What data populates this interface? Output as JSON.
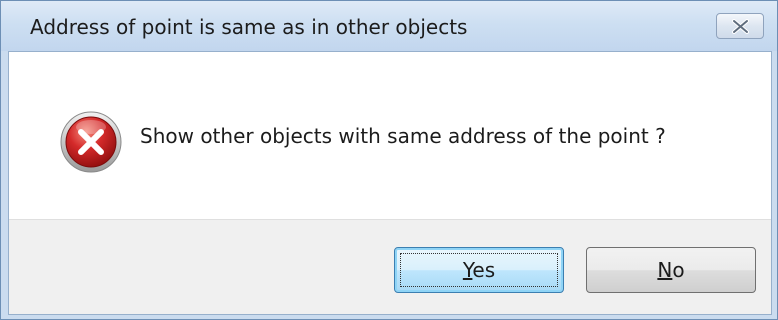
{
  "window": {
    "title": "Address of point is same as in other objects"
  },
  "message": {
    "text": "Show other objects with same address of the point ?"
  },
  "icons": {
    "close": "close-icon",
    "main": "error-icon"
  },
  "buttons": {
    "yes": {
      "mnemonic": "Y",
      "rest": "es"
    },
    "no": {
      "mnemonic": "N",
      "rest": "o"
    }
  },
  "colors": {
    "titlebar": "#cddff2",
    "error_red": "#d42a2a",
    "focus_button_border": "#3c7fb1"
  }
}
